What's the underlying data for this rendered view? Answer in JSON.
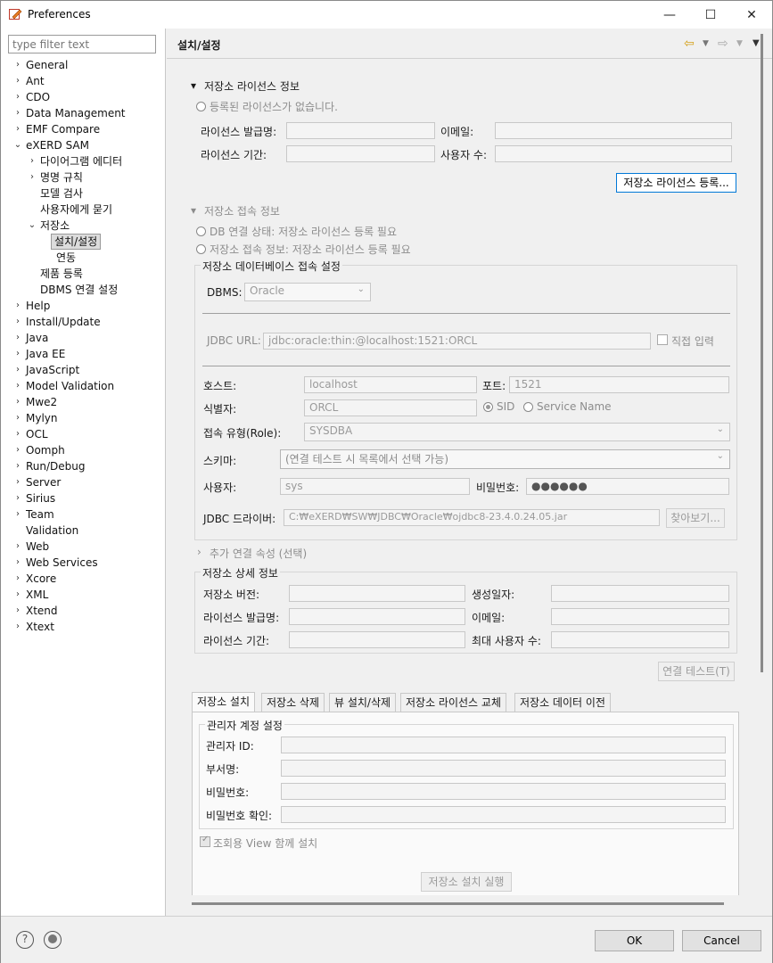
{
  "window": {
    "title": "Preferences",
    "minimize_glyph": "—",
    "maximize_glyph": "☐",
    "close_glyph": "✕"
  },
  "filter": {
    "placeholder": "type filter text"
  },
  "tree": {
    "general": "General",
    "ant": "Ant",
    "cdo": "CDO",
    "data_management": "Data Management",
    "emf_compare": "EMF Compare",
    "exerd_sam": "eXERD SAM",
    "diagram_editor": "다이어그램 에디터",
    "naming_rules": "명명 규칙",
    "model_check": "모델 검사",
    "ask_user": "사용자에게 묻기",
    "repository": "저장소",
    "install_settings": "설치/설정",
    "link": "연동",
    "product_register": "제품 등록",
    "dbms_connection": "DBMS 연결 설정",
    "help": "Help",
    "install_update": "Install/Update",
    "java": "Java",
    "java_ee": "Java EE",
    "javascript": "JavaScript",
    "model_validation": "Model Validation",
    "mwe2": "Mwe2",
    "mylyn": "Mylyn",
    "ocl": "OCL",
    "oomph": "Oomph",
    "run_debug": "Run/Debug",
    "server": "Server",
    "sirius": "Sirius",
    "team": "Team",
    "validation": "Validation",
    "web": "Web",
    "web_services": "Web Services",
    "xcore": "Xcore",
    "xml": "XML",
    "xtend": "Xtend",
    "xtext": "Xtext"
  },
  "page": {
    "title": "설치/설정"
  },
  "license": {
    "section_title": "저장소 라이선스 정보",
    "no_license": "등록된 라이선스가 없습니다.",
    "issuer_label": "라이선스 발급명:",
    "email_label": "이메일:",
    "period_label": "라이선스 기간:",
    "users_label": "사용자 수:",
    "register_button": "저장소 라이선스 등록..."
  },
  "connection_info": {
    "section_title": "저장소 접속 정보",
    "db_status": "DB 연결 상태: 저장소 라이선스 등록 필요",
    "access_info": "저장소 접속 정보: 저장소 라이선스 등록 필요"
  },
  "db_settings": {
    "group_title": "저장소 데이터베이스 접속 설정",
    "dbms_label": "DBMS:",
    "dbms_value": "Oracle",
    "jdbc_url_label": "JDBC URL:",
    "jdbc_url_value": "jdbc:oracle:thin:@localhost:1521:ORCL",
    "direct_input_label": "직접 입력",
    "host_label": "호스트:",
    "host_value": "localhost",
    "port_label": "포트:",
    "port_value": "1521",
    "identifier_label": "식별자:",
    "identifier_value": "ORCL",
    "sid_label": "SID",
    "service_name_label": "Service Name",
    "role_label": "접속 유형(Role):",
    "role_value": "SYSDBA",
    "schema_label": "스키마:",
    "schema_value": "(연결 테스트 시 목록에서 선택 가능)",
    "user_label": "사용자:",
    "user_value": "sys",
    "password_label": "비밀번호:",
    "password_value": "●●●●●●",
    "driver_label": "JDBC 드라이버:",
    "driver_value": "C:₩eXERD₩SW₩JDBC₩Oracle₩ojdbc8-23.4.0.24.05.jar",
    "browse_button": "찾아보기..."
  },
  "extra_props": {
    "title": "추가 연결 속성 (선택)"
  },
  "repo_detail": {
    "group_title": "저장소 상세 정보",
    "version_label": "저장소 버전:",
    "created_label": "생성일자:",
    "issuer_label": "라이선스 발급명:",
    "email_label": "이메일:",
    "period_label": "라이선스 기간:",
    "max_users_label": "최대 사용자 수:"
  },
  "test_button": "연결 테스트(T)",
  "tabs": [
    "저장소 설치",
    "저장소 삭제",
    "뷰 설치/삭제",
    "저장소 라이선스 교체",
    "저장소 데이터 이전"
  ],
  "admin": {
    "group_title": "관리자 계정 설정",
    "id_label": "관리자 ID:",
    "dept_label": "부서명:",
    "password_label": "비밀번호:",
    "password_confirm_label": "비밀번호 확인:",
    "view_checkbox_label": "조회용 View 함께 설치",
    "run_button": "저장소 설치 실행"
  },
  "footer": {
    "help_glyph": "?",
    "ok": "OK",
    "cancel": "Cancel"
  }
}
